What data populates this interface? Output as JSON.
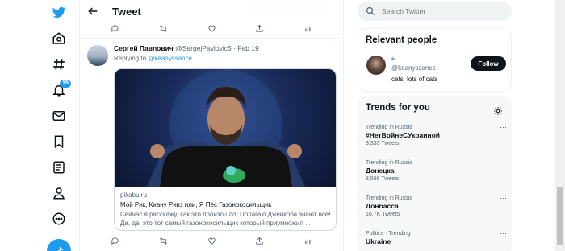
{
  "header": {
    "title": "Tweet"
  },
  "nav": {
    "notification_count": "19"
  },
  "tweet": {
    "author_name": "Сергей Павлович",
    "author_handle": "@SergejPavlovic5",
    "separator": " · ",
    "date": "Feb 19",
    "replying_label": "Replying to ",
    "replying_to": "@keanyssance",
    "card": {
      "domain": "pikabu.ru",
      "title": "Мой Рик, Киану Ривз или, Я Пёс Газонокосильщик",
      "description": "Сейчас я расскажу, как это произошло. Полагаю Джейкоба знают все!  Да, да, это тот самый газонокосильщик который приумножил ..."
    }
  },
  "search": {
    "placeholder": "Search Twitter"
  },
  "relevant": {
    "title": "Relevant people",
    "handle": "@keanyssance",
    "bio": "cats, lots of cats",
    "follow_label": "Follow"
  },
  "trends": {
    "title": "Trends for you",
    "items": [
      {
        "context": "Trending in Russia",
        "name": "#НетВойнеСУкраиной",
        "count": "3,333 Tweets"
      },
      {
        "context": "Trending in Russia",
        "name": "Донецка",
        "count": "8,566 Tweets"
      },
      {
        "context": "Trending in Russia",
        "name": "Донбасса",
        "count": "16.7K Tweets"
      },
      {
        "context": "Politics · Trending",
        "name": "Ukraine",
        "count": ""
      }
    ]
  },
  "colors": {
    "accent": "#1d9bf0",
    "text": "#0f1419",
    "muted": "#536471"
  }
}
